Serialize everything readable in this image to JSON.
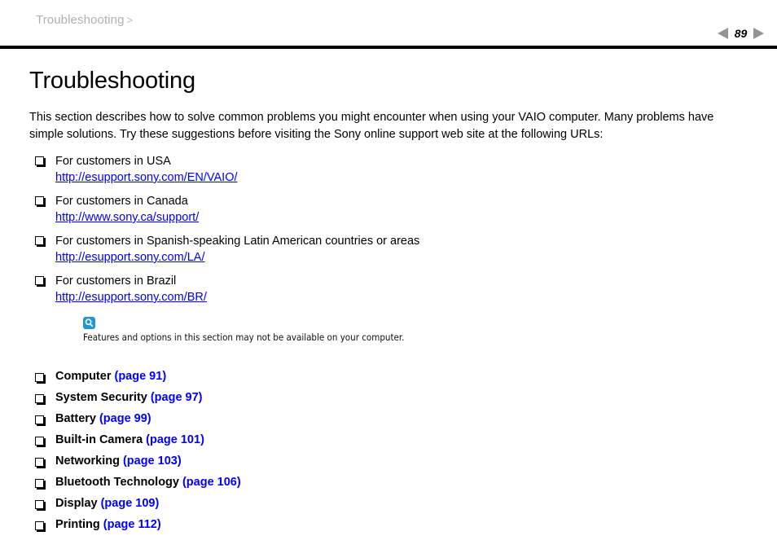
{
  "header": {
    "breadcrumb_label": "Troubleshooting",
    "breadcrumb_separator": ">",
    "page_number": "89",
    "prev_icon": "triangle-left-icon",
    "next_icon": "triangle-right-icon",
    "rule_color": "#000000",
    "breadcrumb_color": "#b0b0b0"
  },
  "main": {
    "title": "Troubleshooting",
    "intro": "This section describes how to solve common problems you might encounter when using your VAIO computer. Many problems have simple solutions. Try these suggestions before visiting the Sony online support web site at the following URLs:",
    "support_links": [
      {
        "label": "For customers in USA",
        "url": "http://esupport.sony.com/EN/VAIO/"
      },
      {
        "label": "For customers in Canada",
        "url": "http://www.sony.ca/support/"
      },
      {
        "label": "For customers in Spanish-speaking Latin American countries or areas",
        "url": "http://esupport.sony.com/LA/"
      },
      {
        "label": "For customers in Brazil",
        "url": "http://esupport.sony.com/BR/"
      }
    ],
    "note": {
      "icon": "magnifier-note-icon",
      "icon_color": "#2196d6",
      "text": "Features and options in this section may not be available on your computer."
    },
    "toc": [
      {
        "label": "Computer",
        "page_ref": "(page 91)"
      },
      {
        "label": "System Security",
        "page_ref": "(page 97)"
      },
      {
        "label": "Battery",
        "page_ref": "(page 99)"
      },
      {
        "label": "Built-in Camera",
        "page_ref": "(page 101)"
      },
      {
        "label": "Networking",
        "page_ref": "(page 103)"
      },
      {
        "label": "Bluetooth Technology",
        "page_ref": "(page 106)"
      },
      {
        "label": "Display",
        "page_ref": "(page 109)"
      },
      {
        "label": "Printing",
        "page_ref": "(page 112)"
      }
    ],
    "link_color": "#0000ff",
    "bullet_icon": "hollow-square-bullet-icon"
  }
}
